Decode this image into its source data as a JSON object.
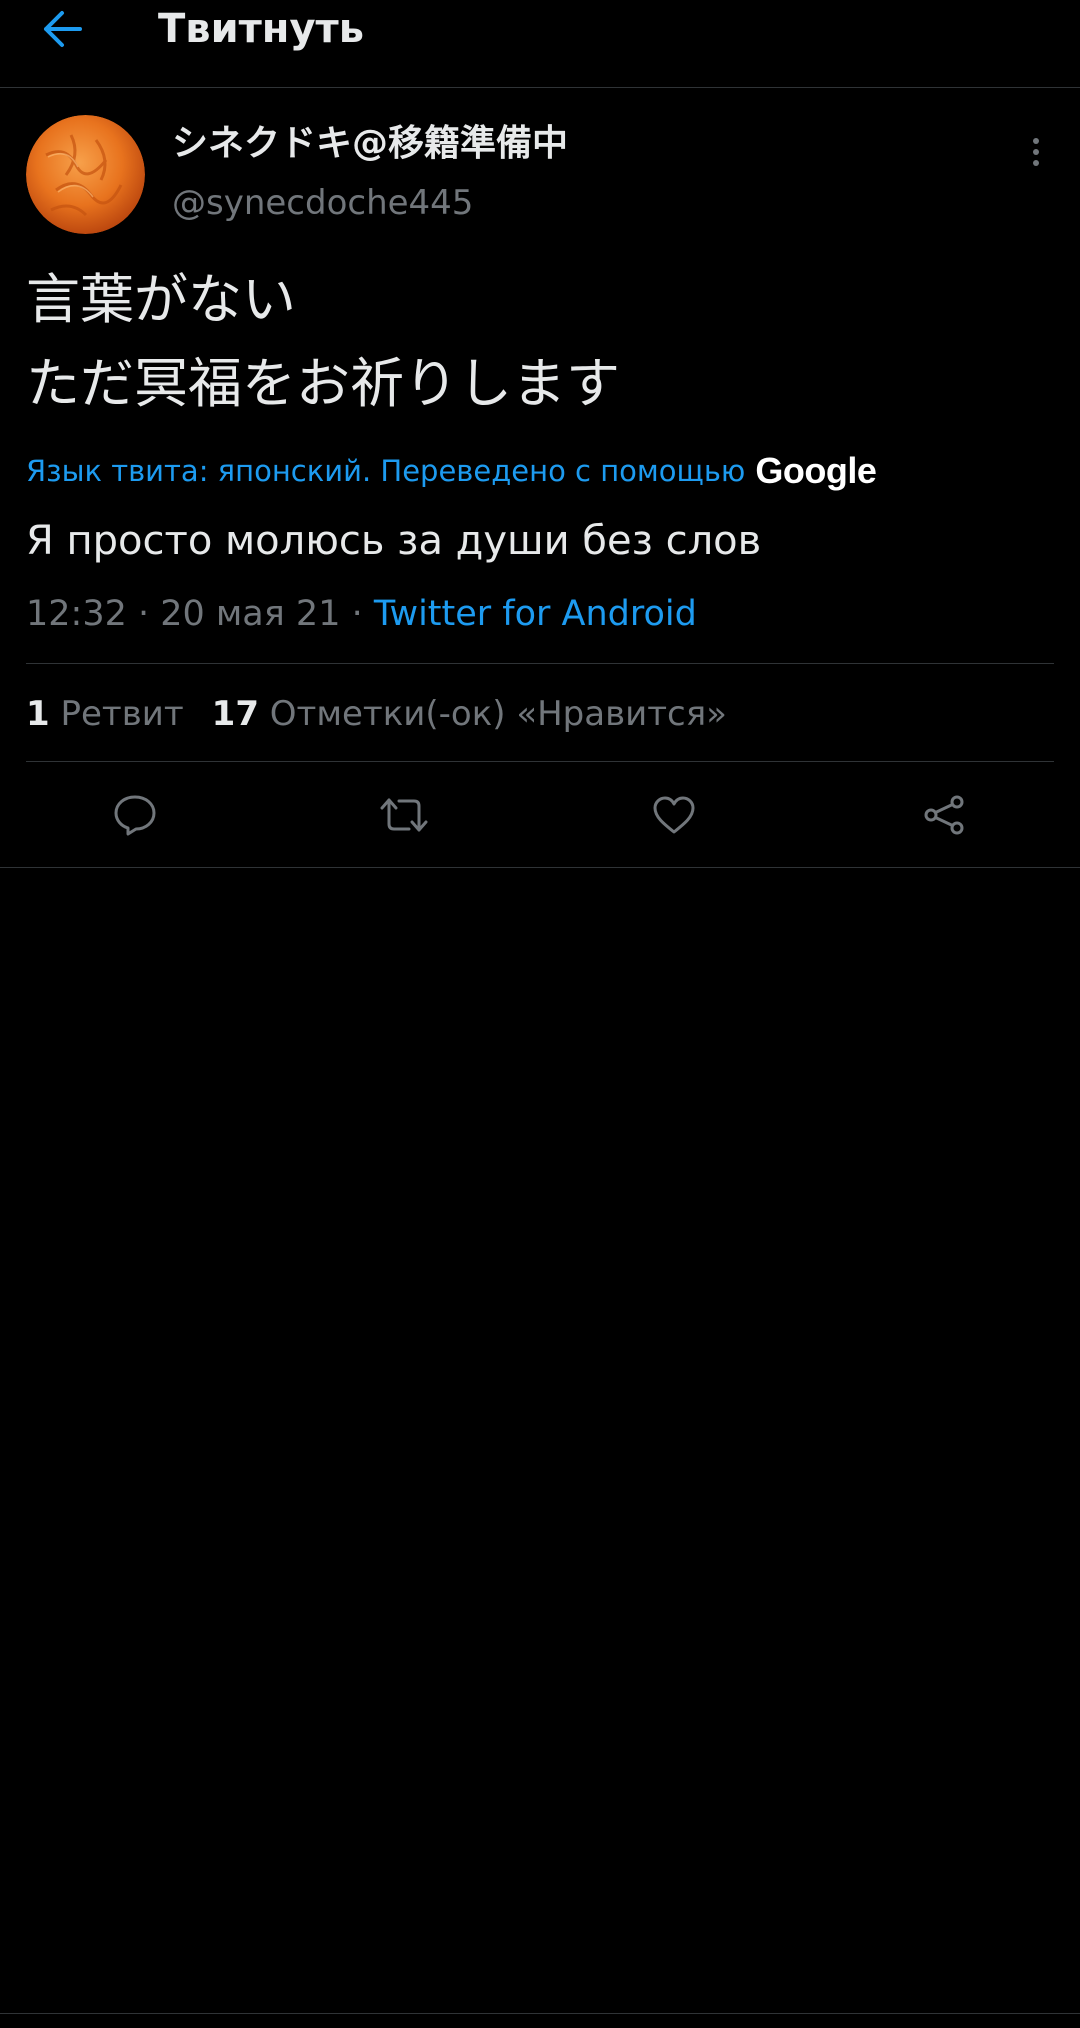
{
  "appbar": {
    "title": "Твитнуть",
    "back_icon": "arrow-left-icon",
    "accent_color": "#1d9bf0"
  },
  "tweet": {
    "display_name": "シネクドキ@移籍準備中",
    "username": "@synecdoche445",
    "text": "言葉がない\nただ冥福をお祈りします",
    "translation_notice": "Язык твита: японский. Переведено с помощью",
    "translation_provider": "Google",
    "translated_text": "Я просто молюсь за души без слов",
    "time_date": "12:32 · 20 мая 21 ·",
    "source": "Twitter for Android",
    "retweet_count": "1",
    "retweet_label": "Ретвит",
    "like_count": "17",
    "like_label": "Отметки(-ок) «Нравится»"
  },
  "actions": {
    "reply_icon": "reply-icon",
    "retweet_icon": "retweet-icon",
    "like_icon": "heart-icon",
    "share_icon": "share-icon"
  },
  "colors": {
    "background": "#000000",
    "text_primary": "#e7e9ea",
    "text_secondary": "#71767b",
    "link": "#1d9bf0",
    "divider": "#2f3336"
  }
}
